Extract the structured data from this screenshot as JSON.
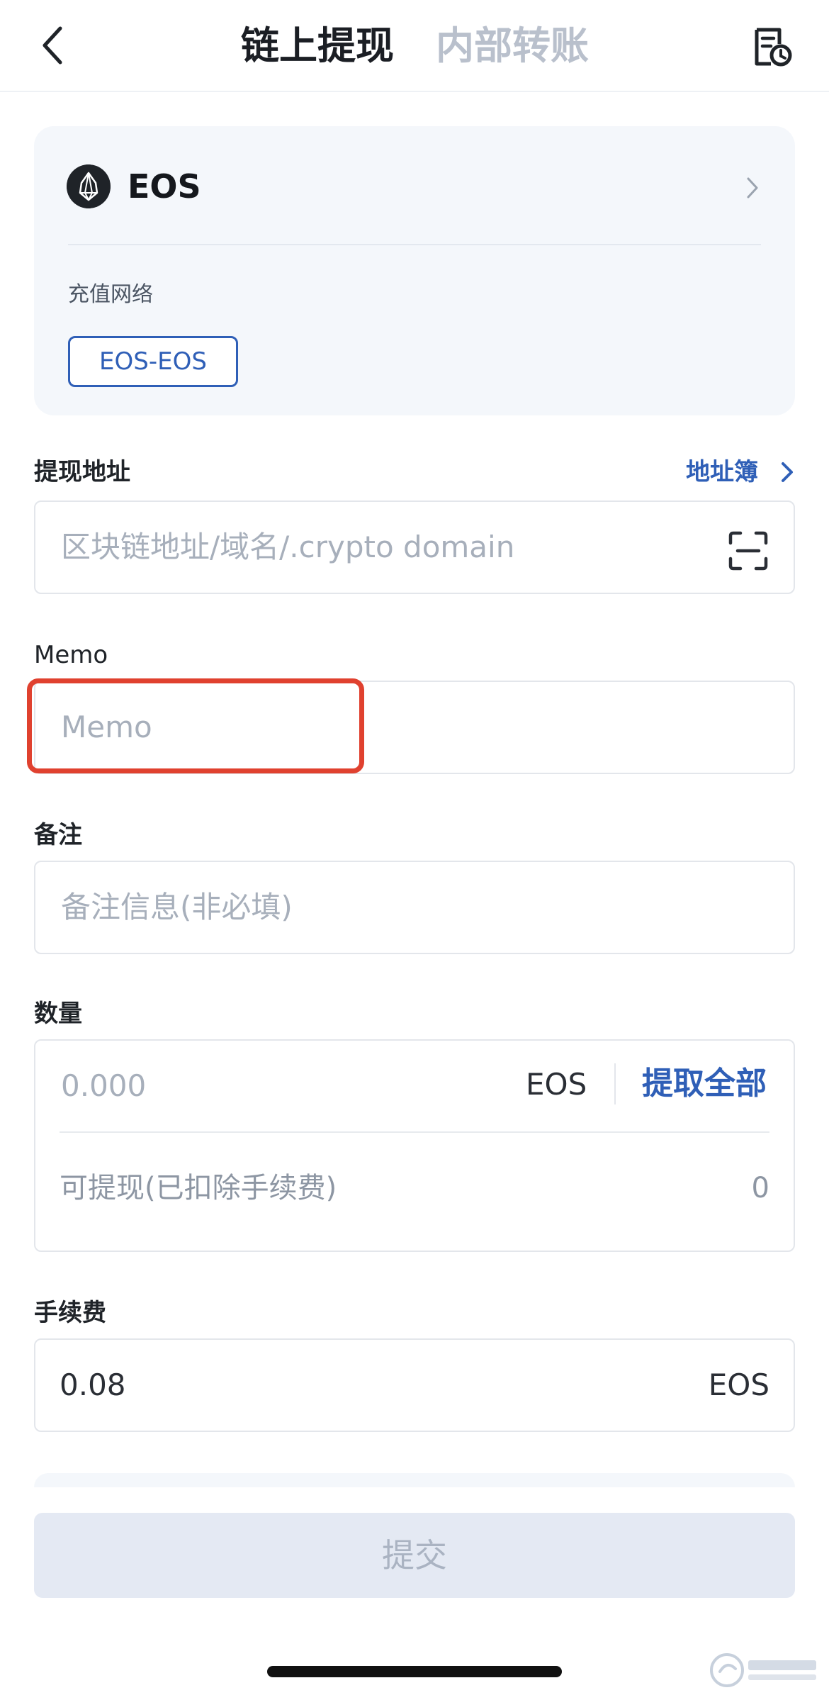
{
  "header": {
    "tabs": [
      {
        "label": "链上提现",
        "active": true
      },
      {
        "label": "内部转账",
        "active": false
      }
    ]
  },
  "coin": {
    "name": "EOS",
    "network_label": "充值网络",
    "network": "EOS-EOS"
  },
  "address": {
    "label": "提现地址",
    "address_book": "地址簿",
    "placeholder": "区块链地址/域名/.crypto domain"
  },
  "memo": {
    "label": "Memo",
    "placeholder": "Memo"
  },
  "remark": {
    "label": "备注",
    "placeholder": "备注信息(非必填)"
  },
  "amount": {
    "label": "数量",
    "placeholder": "0.000",
    "unit": "EOS",
    "withdraw_all": "提取全部",
    "available_label": "可提现(已扣除手续费)",
    "available_value": "0"
  },
  "fee": {
    "label": "手续费",
    "value": "0.08",
    "unit": "EOS"
  },
  "submit": {
    "label": "提交"
  },
  "colors": {
    "accent": "#2f5fb7",
    "highlight": "#e0412f"
  }
}
